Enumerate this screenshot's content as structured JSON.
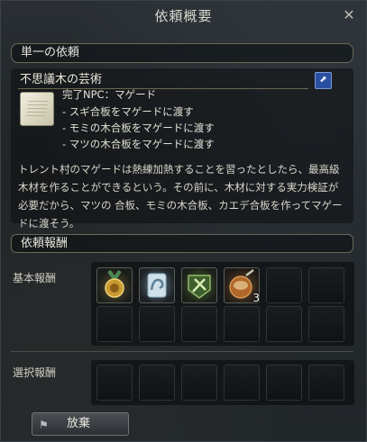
{
  "window": {
    "title": "依頼概要",
    "close_glyph": "✕"
  },
  "quest_type": "単一の依頼",
  "quest": {
    "name": "不思議木の芸術",
    "share_glyph": "⬈",
    "objectives": [
      "完了NPC：マゲード",
      "- スギ合板をマゲードに渡す",
      "- モミの木合板をマゲードに渡す",
      "- マツの木合板をマゲードに渡す"
    ],
    "description": "トレント村のマゲードは熱練加熱することを習ったとしたら、最高級木材を作ることができるという。その前に、木材に対する実力検証が必要だから、マツの 合板、モミの木合板、カエデ合板を作ってマゲードに渡そう。"
  },
  "rewards": {
    "section_title": "依頼報酬",
    "basic_label": "基本報酬",
    "select_label": "選択報酬",
    "basic_items": [
      {
        "icon": "medal-icon",
        "count": ""
      },
      {
        "icon": "strength-skill-icon",
        "count": ""
      },
      {
        "icon": "gathering-skill-icon",
        "count": ""
      },
      {
        "icon": "food-bowl-icon",
        "count": "3"
      }
    ]
  },
  "abandon_button": "放棄"
}
